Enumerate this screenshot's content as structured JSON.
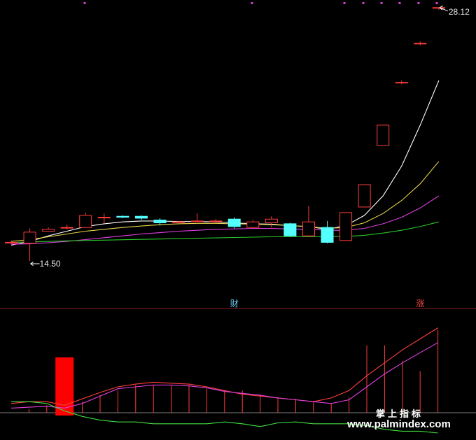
{
  "chart_data": {
    "type": "candlestick",
    "price_panel": {
      "high_label": "28.12",
      "low_label": "14.50",
      "ylim": [
        13.6,
        28.3
      ],
      "markers": [
        {
          "index": 12,
          "text": "财",
          "color": "#6fd3ff"
        },
        {
          "index": 22,
          "text": "涨",
          "color": "#ff4a4a"
        }
      ],
      "candles": [
        {
          "o": 15.5,
          "c": 15.5,
          "h": 15.6,
          "l": 15.4
        },
        {
          "o": 15.45,
          "c": 16.05,
          "h": 16.25,
          "l": 14.5
        },
        {
          "o": 16.1,
          "c": 16.2,
          "h": 16.3,
          "l": 16.1
        },
        {
          "o": 16.3,
          "c": 16.3,
          "h": 16.45,
          "l": 16.2
        },
        {
          "o": 16.3,
          "c": 16.95,
          "h": 17.1,
          "l": 16.3
        },
        {
          "o": 16.85,
          "c": 16.85,
          "h": 17.05,
          "l": 16.5
        },
        {
          "o": 16.9,
          "c": 16.85,
          "h": 16.95,
          "l": 16.8
        },
        {
          "o": 16.9,
          "c": 16.8,
          "h": 16.95,
          "l": 16.7
        },
        {
          "o": 16.7,
          "c": 16.55,
          "h": 16.8,
          "l": 16.4
        },
        {
          "o": 16.6,
          "c": 16.6,
          "h": 16.65,
          "l": 16.55
        },
        {
          "o": 16.65,
          "c": 16.65,
          "h": 17.05,
          "l": 16.6
        },
        {
          "o": 16.65,
          "c": 16.65,
          "h": 16.75,
          "l": 16.55
        },
        {
          "o": 16.75,
          "c": 16.35,
          "h": 16.85,
          "l": 16.25
        },
        {
          "o": 16.3,
          "c": 16.6,
          "h": 16.7,
          "l": 16.25
        },
        {
          "o": 16.55,
          "c": 16.75,
          "h": 16.9,
          "l": 16.3
        },
        {
          "o": 16.5,
          "c": 15.85,
          "h": 16.55,
          "l": 15.8
        },
        {
          "o": 15.85,
          "c": 16.6,
          "h": 17.45,
          "l": 15.8
        },
        {
          "o": 16.3,
          "c": 15.5,
          "h": 16.65,
          "l": 15.45
        },
        {
          "o": 15.6,
          "c": 17.1,
          "h": 17.1,
          "l": 15.6
        },
        {
          "o": 17.4,
          "c": 18.6,
          "h": 18.6,
          "l": 17.4
        },
        {
          "o": 20.7,
          "c": 21.8,
          "h": 21.8,
          "l": 20.7
        },
        {
          "o": 24.1,
          "c": 24.1,
          "h": 24.2,
          "l": 24.0
        },
        {
          "o": 26.2,
          "c": 26.2,
          "h": 26.3,
          "l": 26.1
        },
        {
          "o": 28.12,
          "c": 28.12,
          "h": 28.12,
          "l": 28.0
        }
      ],
      "series": [
        {
          "color": "#ffffff",
          "values": [
            15.35,
            15.55,
            15.85,
            16.1,
            16.35,
            16.5,
            16.6,
            16.65,
            16.65,
            16.62,
            16.62,
            16.6,
            16.55,
            16.5,
            16.48,
            16.4,
            16.35,
            16.2,
            16.4,
            16.95,
            18.0,
            19.6,
            21.8,
            24.2
          ]
        },
        {
          "color": "#e6d24a",
          "values": [
            15.55,
            15.65,
            15.8,
            15.95,
            16.1,
            16.2,
            16.3,
            16.38,
            16.45,
            16.5,
            16.52,
            16.52,
            16.5,
            16.48,
            16.45,
            16.4,
            16.35,
            16.25,
            16.3,
            16.55,
            17.05,
            17.75,
            18.65,
            19.85
          ]
        },
        {
          "color": "#e040e0",
          "values": [
            15.4,
            15.42,
            15.48,
            15.55,
            15.65,
            15.75,
            15.85,
            15.95,
            16.02,
            16.1,
            16.15,
            16.2,
            16.22,
            16.25,
            16.25,
            16.22,
            16.2,
            16.15,
            16.15,
            16.25,
            16.5,
            16.85,
            17.35,
            18.0
          ]
        },
        {
          "color": "#28c828",
          "values": [
            15.5,
            15.52,
            15.55,
            15.58,
            15.6,
            15.62,
            15.64,
            15.66,
            15.68,
            15.7,
            15.72,
            15.74,
            15.76,
            15.78,
            15.8,
            15.8,
            15.8,
            15.8,
            15.82,
            15.88,
            16.0,
            16.15,
            16.35,
            16.6
          ]
        }
      ]
    },
    "indicator_panel": {
      "ylim": [
        0,
        100
      ],
      "bars": [
        0,
        4,
        8,
        6,
        12,
        19,
        24,
        30,
        30,
        30,
        30,
        26,
        24,
        24,
        20,
        17,
        15,
        13,
        10,
        17,
        73,
        73,
        56,
        45,
        90
      ],
      "highlight_bar": {
        "index": 3,
        "value": 60,
        "color": "#ff0000"
      },
      "series": [
        {
          "color": "#ff4040",
          "values": [
            10,
            12,
            12,
            8,
            15,
            22,
            28,
            31,
            33,
            32,
            31,
            28,
            24,
            20,
            18,
            16,
            14,
            12,
            16,
            24,
            40,
            54,
            68,
            80,
            92
          ]
        },
        {
          "color": "#e040e0",
          "values": [
            5,
            6,
            7,
            5,
            10,
            18,
            26,
            28,
            30,
            30,
            29,
            27,
            23,
            21,
            19,
            16,
            14,
            12,
            10,
            14,
            28,
            42,
            54,
            65,
            76
          ]
        },
        {
          "color": "#40e040",
          "values": [
            12,
            12,
            10,
            2,
            -4,
            -8,
            -10,
            -10,
            -12,
            -12,
            -12,
            -12,
            -10,
            -12,
            -15,
            -11,
            -10,
            -12,
            -12,
            -12,
            -14,
            -18,
            -20,
            -20,
            -22
          ]
        }
      ]
    }
  },
  "watermark": {
    "line1": "掌上指标",
    "line2": "www.palmindex.com"
  }
}
